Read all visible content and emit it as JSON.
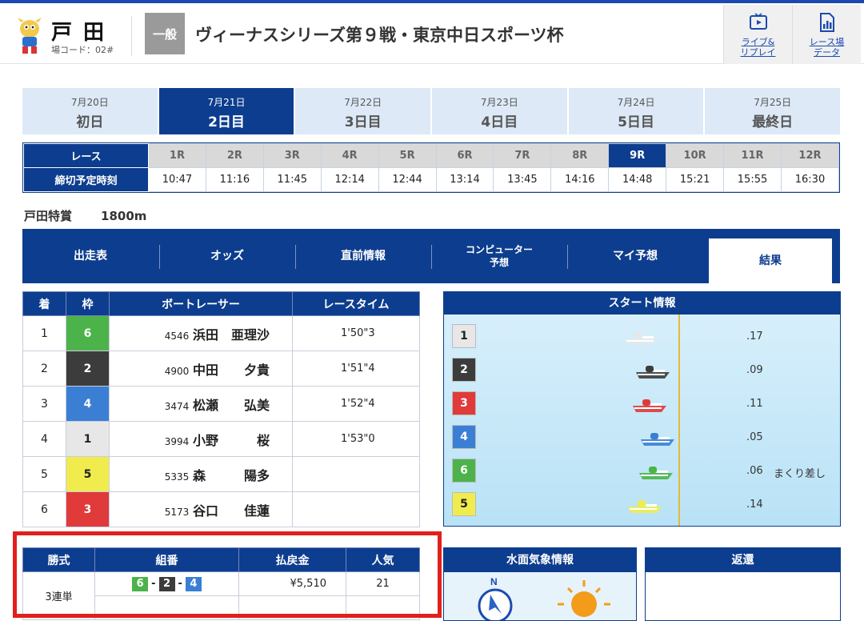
{
  "header": {
    "venue": "戸田",
    "venue_code": "場コード：02#",
    "grade": "一般",
    "title": "ヴィーナスシリーズ第９戦・東京中日スポーツ杯",
    "buttons": [
      {
        "label1": "ライブ&",
        "label2": "リプレイ",
        "icon": "play-video-icon"
      },
      {
        "label1": "レース場",
        "label2": "データ",
        "icon": "chart-data-icon"
      }
    ]
  },
  "days": [
    {
      "date": "7月20日",
      "label": "初日"
    },
    {
      "date": "7月21日",
      "label": "2日目",
      "active": true
    },
    {
      "date": "7月22日",
      "label": "3日目"
    },
    {
      "date": "7月23日",
      "label": "4日目"
    },
    {
      "date": "7月24日",
      "label": "5日目"
    },
    {
      "date": "7月25日",
      "label": "最終日"
    }
  ],
  "races": {
    "row1_label": "レース",
    "row2_label": "締切予定時刻",
    "numbers": [
      "1R",
      "2R",
      "3R",
      "4R",
      "5R",
      "6R",
      "7R",
      "8R",
      "9R",
      "10R",
      "11R",
      "12R"
    ],
    "times": [
      "10:47",
      "11:16",
      "11:45",
      "12:14",
      "12:44",
      "13:14",
      "13:45",
      "14:16",
      "14:48",
      "15:21",
      "15:55",
      "16:30"
    ],
    "active_index": 8
  },
  "race_info": {
    "name": "戸田特賞",
    "distance": "1800m"
  },
  "tabs": [
    {
      "label": "出走表"
    },
    {
      "label": "オッズ"
    },
    {
      "label": "直前情報"
    },
    {
      "label": "コンピューター",
      "sub": "予想"
    },
    {
      "label": "マイ予想"
    },
    {
      "label": "結果",
      "active": true
    }
  ],
  "results": {
    "headers": [
      "着",
      "枠",
      "ボートレーサー",
      "レースタイム"
    ],
    "rows": [
      {
        "pos": "1",
        "waku": "6",
        "num": "4546",
        "name": "浜田　亜理沙",
        "time": "1'50\"3"
      },
      {
        "pos": "2",
        "waku": "2",
        "num": "4900",
        "name": "中田　　夕貴",
        "time": "1'51\"4"
      },
      {
        "pos": "3",
        "waku": "4",
        "num": "3474",
        "name": "松瀬　　弘美",
        "time": "1'52\"4"
      },
      {
        "pos": "4",
        "waku": "1",
        "num": "3994",
        "name": "小野　　　桜",
        "time": "1'53\"0"
      },
      {
        "pos": "5",
        "waku": "5",
        "num": "5335",
        "name": "森　　　陽多",
        "time": ""
      },
      {
        "pos": "6",
        "waku": "3",
        "num": "5173",
        "name": "谷口　　佳蓮",
        "time": ""
      }
    ]
  },
  "start": {
    "title": "スタート情報",
    "rows": [
      {
        "course": "1",
        "st": ".17",
        "tech": ""
      },
      {
        "course": "2",
        "st": ".09",
        "tech": ""
      },
      {
        "course": "3",
        "st": ".11",
        "tech": ""
      },
      {
        "course": "4",
        "st": ".05",
        "tech": ""
      },
      {
        "course": "6",
        "st": ".06",
        "tech": "まくり差し"
      },
      {
        "course": "5",
        "st": ".14",
        "tech": ""
      }
    ],
    "colors": {
      "1": "#e7e7e7",
      "2": "#3c3c3c",
      "3": "#e03a3a",
      "4": "#3a7fd4",
      "5": "#f0ec4e",
      "6": "#4cb34a"
    }
  },
  "payout": {
    "headers": [
      "勝式",
      "組番",
      "払戻金",
      "人気"
    ],
    "type": "3連単",
    "combo": [
      "6",
      "2",
      "4"
    ],
    "amount": "¥5,510",
    "pop": "21"
  },
  "weather": {
    "title": "水面気象情報",
    "wind_dir": "N"
  },
  "henkan": {
    "title": "返還"
  }
}
